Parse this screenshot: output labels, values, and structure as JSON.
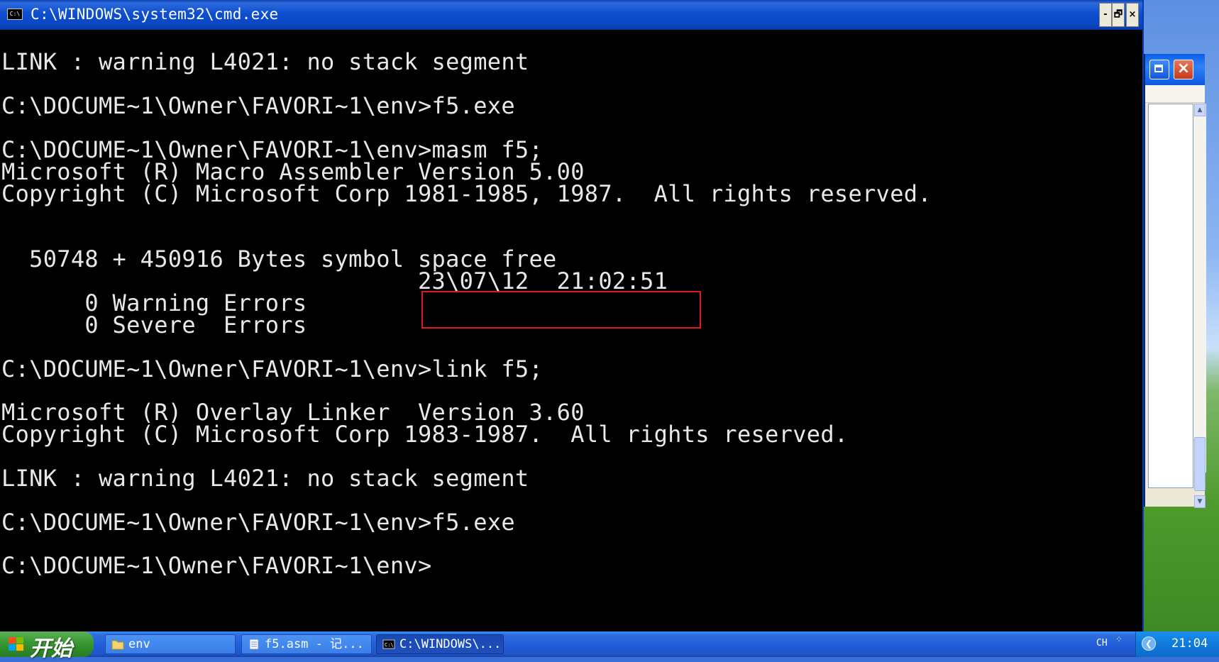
{
  "window": {
    "title": "C:\\WINDOWS\\system32\\cmd.exe",
    "icon_label": "C:\\",
    "minimize_glyph": "-",
    "restore_glyph": "🗗",
    "close_glyph": "×"
  },
  "console": {
    "lines": [
      "LINK : warning L4021: no stack segment",
      "",
      "C:\\DOCUME~1\\Owner\\FAVORI~1\\env>f5.exe",
      "",
      "C:\\DOCUME~1\\Owner\\FAVORI~1\\env>masm f5;",
      "Microsoft (R) Macro Assembler Version 5.00",
      "Copyright (C) Microsoft Corp 1981-1985, 1987.  All rights reserved.",
      "",
      "",
      "  50748 + 450916 Bytes symbol space free",
      "                              23\\07\\12  21:02:51",
      "      0 Warning Errors",
      "      0 Severe  Errors",
      "",
      "C:\\DOCUME~1\\Owner\\FAVORI~1\\env>link f5;",
      "",
      "Microsoft (R) Overlay Linker  Version 3.60",
      "Copyright (C) Microsoft Corp 1983-1987.  All rights reserved.",
      "",
      "LINK : warning L4021: no stack segment",
      "",
      "C:\\DOCUME~1\\Owner\\FAVORI~1\\env>f5.exe",
      "",
      "C:\\DOCUME~1\\Owner\\FAVORI~1\\env>"
    ],
    "text_color": "#e8e8e8",
    "background_color": "#000000",
    "highlight_color": "#e01c1c"
  },
  "taskbar": {
    "start_label": "开始",
    "tasks": [
      {
        "label": "env",
        "icon": "folder-icon",
        "active": false
      },
      {
        "label": "f5.asm - 记...",
        "icon": "notepad-icon",
        "active": false
      },
      {
        "label": "C:\\WINDOWS\\...",
        "icon": "cmd-icon",
        "active": true
      }
    ],
    "language": "CH",
    "clock": "21:04"
  }
}
